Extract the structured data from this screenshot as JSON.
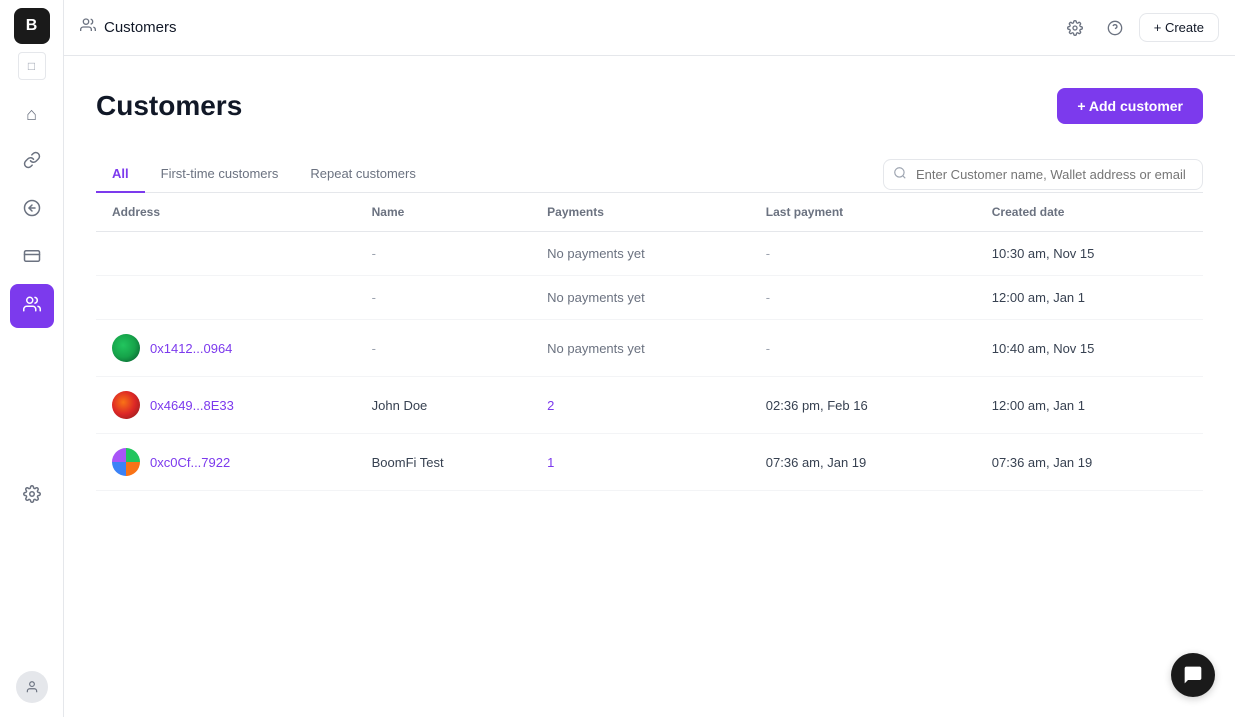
{
  "app": {
    "logo": "B",
    "topbar": {
      "breadcrumb_icon": "👤",
      "title": "Customers",
      "create_label": "+ Create"
    }
  },
  "sidebar": {
    "items": [
      {
        "id": "home",
        "icon": "⌂",
        "active": false
      },
      {
        "id": "link",
        "icon": "🔗",
        "active": false
      },
      {
        "id": "arrow-right",
        "icon": "↗",
        "active": false
      },
      {
        "id": "list",
        "icon": "☰",
        "active": false
      },
      {
        "id": "customers",
        "icon": "👥",
        "active": true
      },
      {
        "id": "settings",
        "icon": "⚙",
        "active": false
      }
    ]
  },
  "page": {
    "title": "Customers",
    "add_button": "+ Add customer",
    "tabs": [
      {
        "id": "all",
        "label": "All",
        "active": true
      },
      {
        "id": "first-time",
        "label": "First-time customers",
        "active": false
      },
      {
        "id": "repeat",
        "label": "Repeat customers",
        "active": false
      }
    ],
    "search": {
      "placeholder": "Enter Customer name, Wallet address or email"
    },
    "table": {
      "columns": [
        "Address",
        "Name",
        "Payments",
        "Last payment",
        "Created date"
      ],
      "rows": [
        {
          "avatar": null,
          "address": "",
          "address_display": "",
          "name": "-",
          "payments": "No payments yet",
          "payments_type": "none",
          "last_payment": "-",
          "created_date": "10:30 am, Nov 15"
        },
        {
          "avatar": null,
          "address": "",
          "address_display": "",
          "name": "-",
          "payments": "No payments yet",
          "payments_type": "none",
          "last_payment": "-",
          "created_date": "12:00 am, Jan 1"
        },
        {
          "avatar": "green-gradient",
          "address": "0x1412...0964",
          "address_display": "0x1412...0964",
          "name": "-",
          "payments": "No payments yet",
          "payments_type": "none",
          "last_payment": "-",
          "created_date": "10:40 am, Nov 15"
        },
        {
          "avatar": "red-orange-gradient",
          "address": "0x4649...8E33",
          "address_display": "0x4649...8E33",
          "name": "John Doe",
          "payments": "2",
          "payments_type": "count",
          "last_payment": "02:36 pm, Feb 16",
          "created_date": "12:00 am, Jan 1"
        },
        {
          "avatar": "multi-gradient",
          "address": "0xc0Cf...7922",
          "address_display": "0xc0Cf...7922",
          "name": "BoomFi Test",
          "payments": "1",
          "payments_type": "count",
          "last_payment": "07:36 am, Jan 19",
          "created_date": "07:36 am, Jan 19"
        }
      ]
    }
  },
  "colors": {
    "accent": "#7c3aed",
    "sidebar_active_bg": "#7c3aed"
  }
}
